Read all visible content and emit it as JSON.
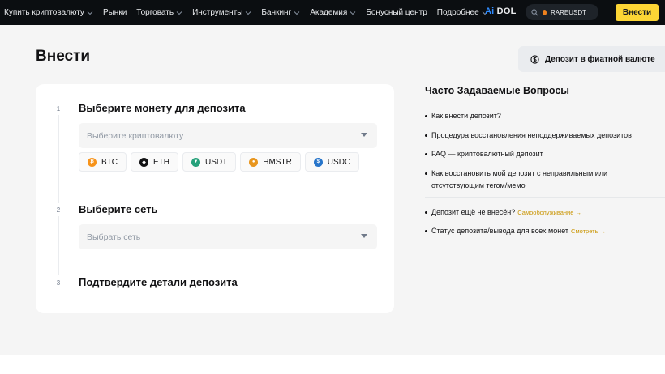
{
  "nav": {
    "items": [
      {
        "label": "Купить криптовалюту",
        "dropdown": true
      },
      {
        "label": "Рынки",
        "dropdown": false
      },
      {
        "label": "Торговать",
        "dropdown": true
      },
      {
        "label": "Инструменты",
        "dropdown": true
      },
      {
        "label": "Банкинг",
        "dropdown": true
      },
      {
        "label": "Академия",
        "dropdown": true
      },
      {
        "label": "Бонусный центр",
        "dropdown": false
      },
      {
        "label": "Подробнее",
        "dropdown": true
      }
    ],
    "logo_prefix": "Ai",
    "logo_suffix": "DOL",
    "search_value": "RAREUSDT",
    "deposit_label": "Внести"
  },
  "page": {
    "title": "Внести",
    "fiat_button": "Депозит в фиатной валюте"
  },
  "steps": [
    {
      "number": "1",
      "title": "Выберите монету для депозита",
      "placeholder": "Выберите криптовалюту"
    },
    {
      "number": "2",
      "title": "Выберите сеть",
      "placeholder": "Выбрать сеть"
    },
    {
      "number": "3",
      "title": "Подтвердите детали депозита"
    }
  ],
  "coins": [
    {
      "symbol": "BTC",
      "color": "#f7931a",
      "icon": "bitcoin-icon"
    },
    {
      "symbol": "ETH",
      "color": "#121214",
      "icon": "ethereum-icon"
    },
    {
      "symbol": "USDT",
      "color": "#26a17b",
      "icon": "tether-icon"
    },
    {
      "symbol": "HMSTR",
      "color": "#e8961e",
      "icon": "hamster-icon"
    },
    {
      "symbol": "USDC",
      "color": "#2775ca",
      "icon": "usdc-icon"
    }
  ],
  "faq": {
    "title": "Часто Задаваемые Вопросы",
    "items": [
      "Как внести депозит?",
      "Процедура восстановления неподдерживаемых депозитов",
      "FAQ — криптовалютный депозит",
      "Как восстановить мой депозит с неправильным или отсутствующим тегом/мемо"
    ],
    "extra": [
      {
        "text": "Депозит ещё не внесён?",
        "link": "Самообслуживание →"
      },
      {
        "text": "Статус депозита/вывода для всех монет",
        "link": "Смотреть →"
      }
    ]
  },
  "colors": {
    "accent": "#fcd535",
    "topbar": "#0b0e11",
    "link": "#c99400"
  }
}
